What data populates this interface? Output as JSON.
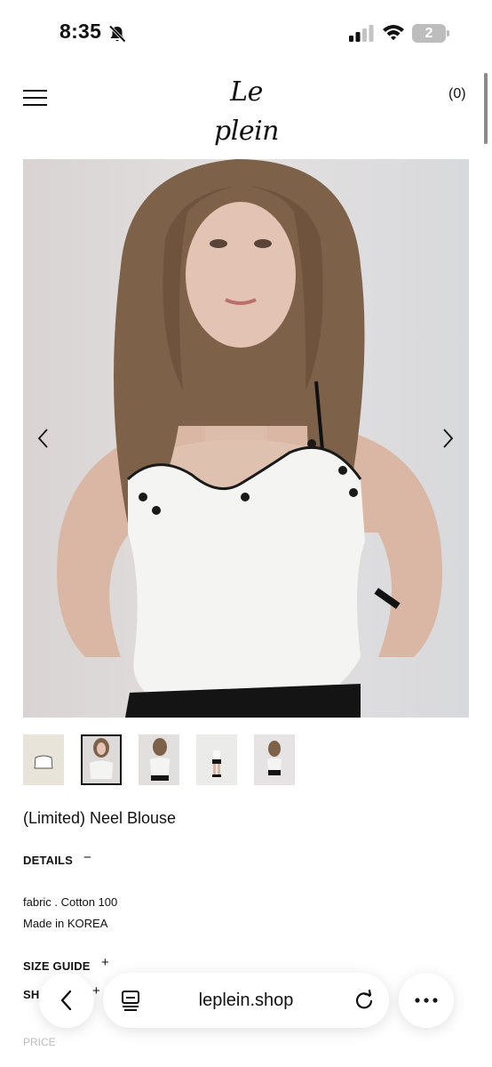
{
  "status_bar": {
    "time": "8:35",
    "battery_level": "2"
  },
  "header": {
    "logo": "Le plein",
    "cart_label": "(0)"
  },
  "gallery": {
    "prev_icon": "chevron-left-icon",
    "next_icon": "chevron-right-icon",
    "thumbnail_count": 5,
    "active_thumbnail": 2
  },
  "product": {
    "title": "(Limited) Neel Blouse",
    "details_label": "DETAILS",
    "details_toggle": "−",
    "details_lines": [
      "fabric . Cotton 100",
      "Made in KOREA"
    ],
    "size_guide_label": "SIZE GUIDE",
    "size_guide_toggle": "+",
    "shipping_label": "SH",
    "shipping_toggle": "+",
    "price_label": "PRICE"
  },
  "browser": {
    "url": "leplein.shop",
    "back_icon": "chevron-left-icon",
    "tabs_icon": "tabs-icon",
    "reload_icon": "reload-icon",
    "more_icon": "more-icon"
  },
  "colors": {
    "text": "#111111",
    "muted": "#bbbbbb",
    "battery": "#bdbdbd"
  }
}
